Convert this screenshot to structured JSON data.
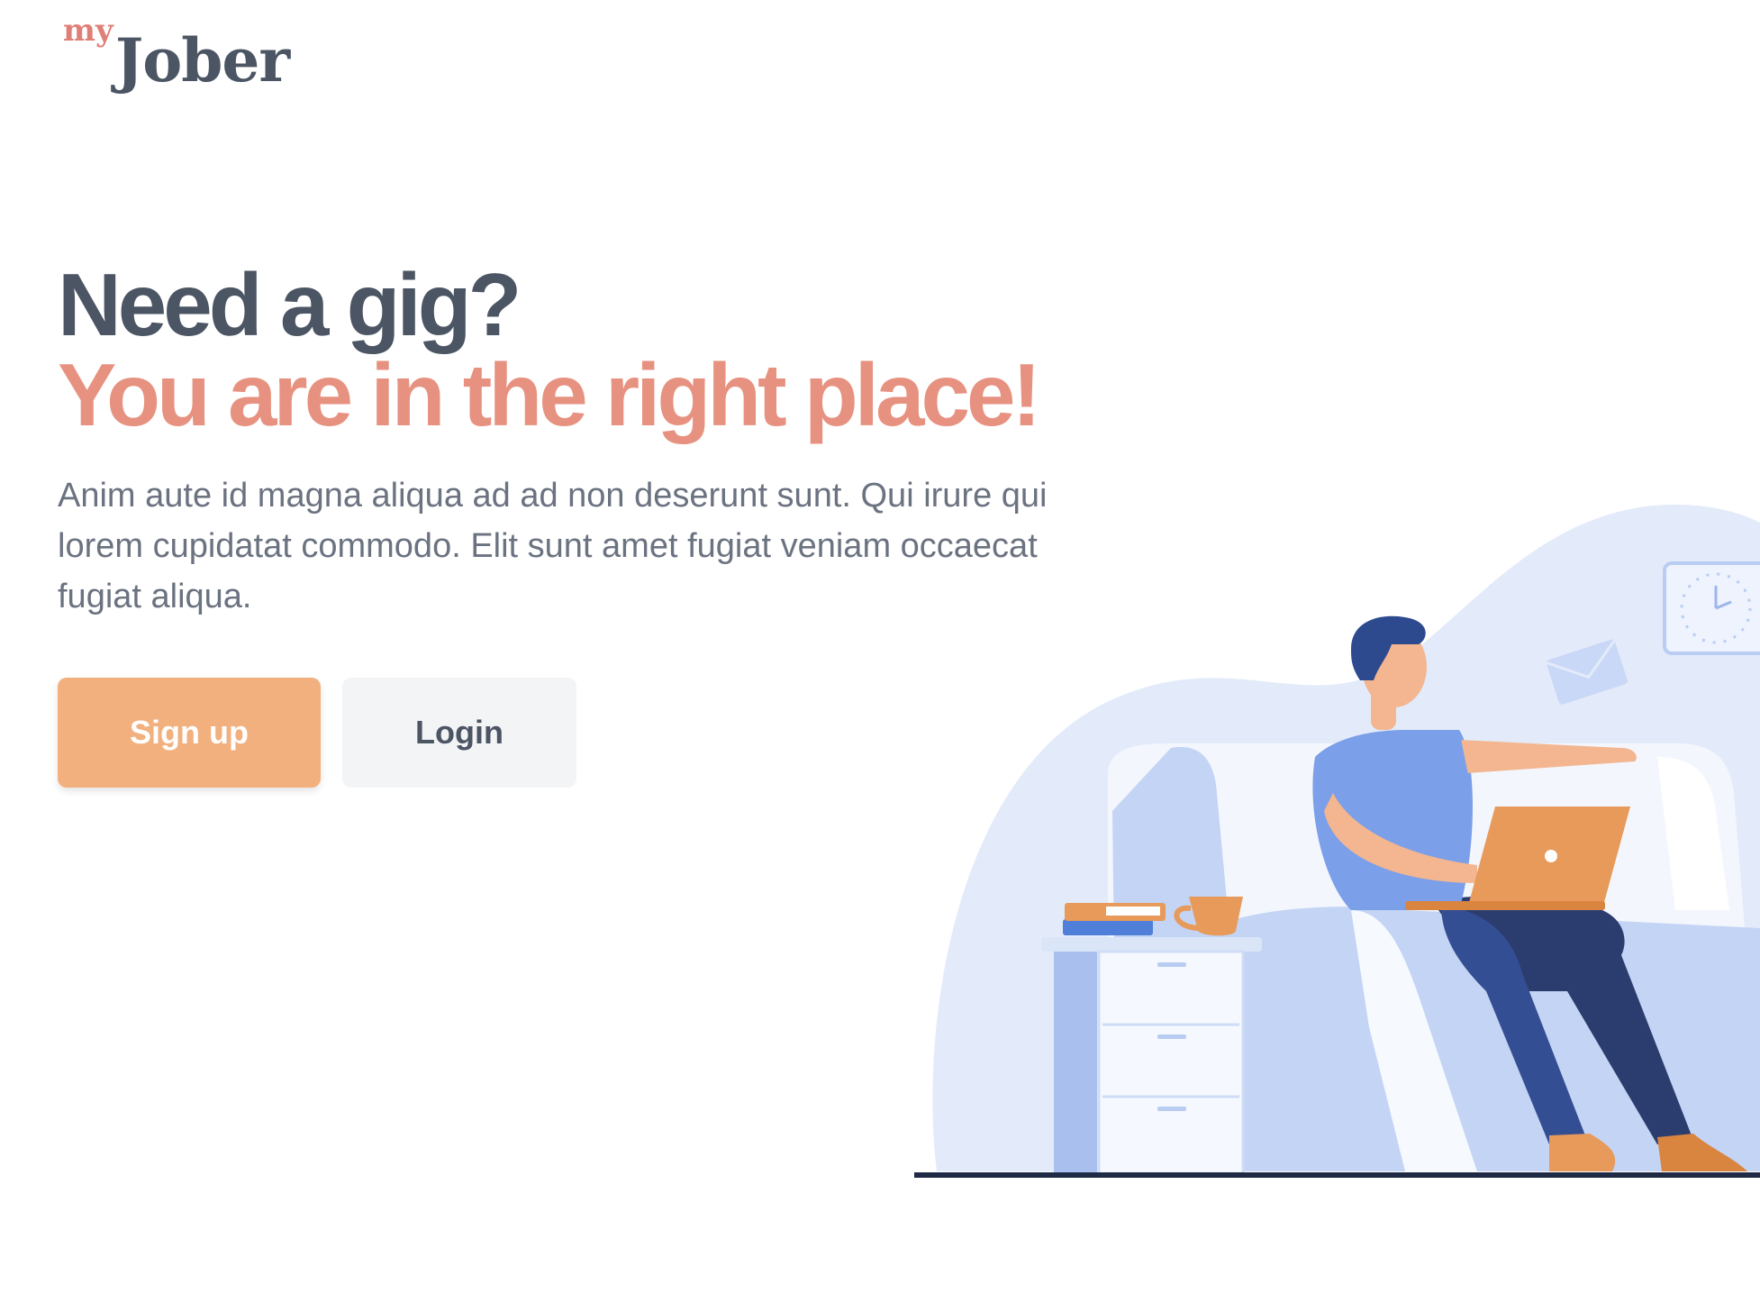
{
  "logo": {
    "prefix": "my",
    "name": "Jober"
  },
  "hero": {
    "headline_line1": "Need a gig?",
    "headline_line2": "You are in the right place!",
    "description": "Anim aute id magna aliqua ad ad non deserunt sunt. Qui irure qui lorem cupidatat commodo. Elit sunt amet fugiat veniam occaecat fugiat aliqua."
  },
  "actions": {
    "signup_label": "Sign up",
    "login_label": "Login"
  },
  "colors": {
    "heading": "#4b5563",
    "accent_heading": "#e79280",
    "primary_button": "#f2b07e",
    "secondary_button": "#f3f4f6",
    "logo_accent": "#e07f78"
  },
  "illustration": {
    "subject": "person-with-laptop-on-sofa"
  }
}
